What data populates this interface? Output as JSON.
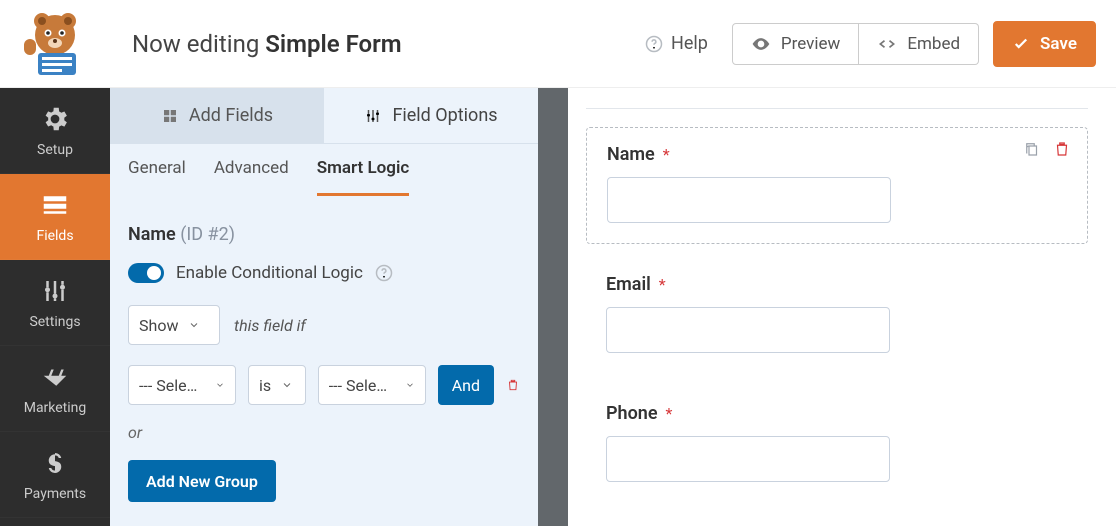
{
  "header": {
    "editing_prefix": "Now editing ",
    "form_name": "Simple Form"
  },
  "toolbar": {
    "help": "Help",
    "preview": "Preview",
    "embed": "Embed",
    "save": "Save"
  },
  "sidebar": {
    "items": [
      {
        "label": "Setup"
      },
      {
        "label": "Fields"
      },
      {
        "label": "Settings"
      },
      {
        "label": "Marketing"
      },
      {
        "label": "Payments"
      }
    ]
  },
  "panel": {
    "tabs": {
      "add": "Add Fields",
      "options": "Field Options"
    },
    "subtabs": {
      "general": "General",
      "advanced": "Advanced",
      "smart": "Smart Logic"
    },
    "field_name": "Name",
    "field_id": "(ID #2)",
    "enable_cl": "Enable Conditional Logic",
    "action_select": "Show",
    "action_hint": "this field if",
    "rule": {
      "field_placeholder": "--- Select Field ---",
      "operator": "is",
      "value_placeholder": "--- Select Choice ---",
      "and": "And"
    },
    "or": "or",
    "add_group": "Add New Group"
  },
  "preview": {
    "fields": [
      {
        "label": "Name",
        "required": true,
        "selected": true
      },
      {
        "label": "Email",
        "required": true,
        "selected": false
      },
      {
        "label": "Phone",
        "required": true,
        "selected": false
      }
    ],
    "asterisk": "*"
  }
}
